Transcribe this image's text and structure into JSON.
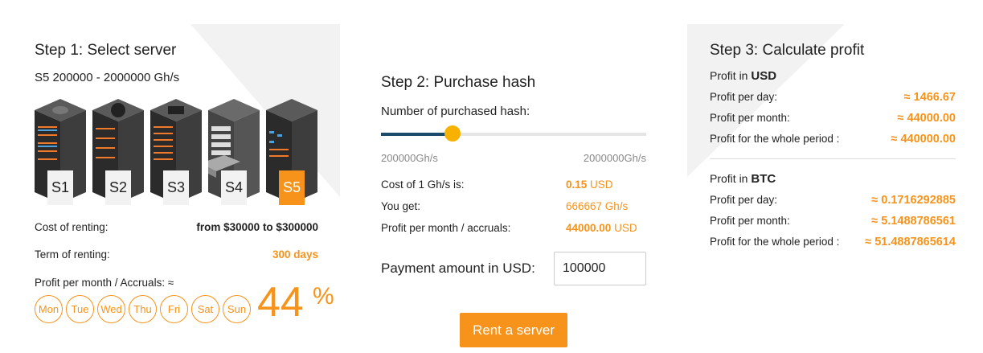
{
  "step1": {
    "title": "Step 1: Select server",
    "subtitle": "S5 200000 - 2000000 Gh/s",
    "servers": [
      {
        "label": "S1",
        "active": false
      },
      {
        "label": "S2",
        "active": false
      },
      {
        "label": "S3",
        "active": false
      },
      {
        "label": "S4",
        "active": false
      },
      {
        "label": "S5",
        "active": true
      }
    ],
    "cost_label": "Cost of renting:",
    "cost_value": "from $30000 to $300000",
    "term_label": "Term of renting:",
    "term_value": "300 days",
    "accruals_label": "Profit per month / Accruals: ≈",
    "days": [
      "Mon",
      "Tue",
      "Wed",
      "Thu",
      "Fri",
      "Sat",
      "Sun"
    ],
    "percent_value": "44",
    "percent_sign": "%"
  },
  "step2": {
    "title": "Step 2: Purchase hash",
    "slider_label": "Number of purchased hash:",
    "slider_min": "200000Gh/s",
    "slider_max": "2000000Gh/s",
    "slider_fraction": 0.27,
    "cost_label": "Cost of 1 Gh/s is:",
    "cost_num": "0.15",
    "cost_unit": " USD",
    "get_label": "You get:",
    "get_value": "666667 Gh/s",
    "profit_label": "Profit per month / accruals:",
    "profit_num": "44000.00",
    "profit_unit": " USD",
    "payment_label": "Payment amount in USD:",
    "payment_value": "100000",
    "rent_button": "Rent a server"
  },
  "step3": {
    "title": "Step 3: Calculate profit",
    "usd_prefix": "Profit in ",
    "usd_currency": "USD",
    "usd_rows": [
      {
        "label": "Profit per day:",
        "value": "≈ 1466.67"
      },
      {
        "label": "Profit per month:",
        "value": "≈ 44000.00"
      },
      {
        "label": "Profit for the whole period :",
        "value": "≈ 440000.00"
      }
    ],
    "btc_prefix": "Profit in ",
    "btc_currency": "BTC",
    "btc_rows": [
      {
        "label": "Profit per day:",
        "value": "≈ 0.1716292885"
      },
      {
        "label": "Profit per month:",
        "value": "≈ 5.1488786561"
      },
      {
        "label": "Profit for the whole period :",
        "value": "≈ 51.4887865614"
      }
    ]
  },
  "colors": {
    "accent": "#f7931a",
    "slider_fill": "#1c4a6b",
    "slider_thumb": "#f7b100"
  }
}
